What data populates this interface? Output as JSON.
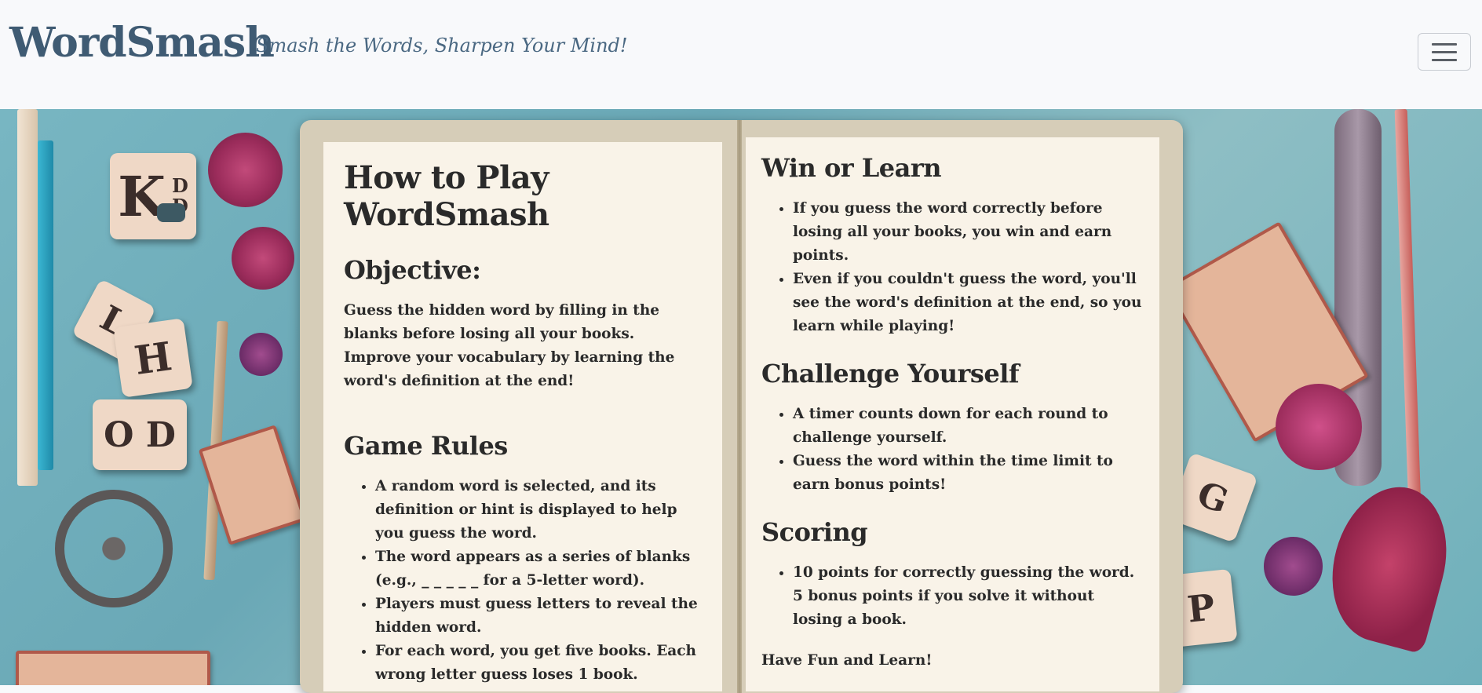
{
  "header": {
    "brand": "WordSmash",
    "tagline": "Smash the Words, Sharpen Your Mind!"
  },
  "background_tiles": [
    "K",
    "D",
    "D",
    "L",
    "H",
    "O D",
    "P",
    "G"
  ],
  "left_page": {
    "title": "How to Play WordSmash",
    "objective_heading": "Objective:",
    "objective_text": "Guess the hidden word by filling in the blanks before losing all your books. Improve your vocabulary by learning the word's definition at the end!",
    "rules_heading": "Game Rules",
    "rules": [
      "A random word is selected, and its definition or hint is displayed to help you guess the word.",
      "The word appears as a series of blanks (e.g., _ _ _ _ _ for a 5-letter word).",
      "Players must guess letters to reveal the hidden word.",
      "For each word, you get five books. Each wrong letter guess loses 1 book."
    ]
  },
  "right_page": {
    "win_heading": "Win or Learn",
    "win_items": [
      "If you guess the word correctly before losing all your books, you win and earn points.",
      "Even if you couldn't guess the word, you'll see the word's definition at the end, so you learn while playing!"
    ],
    "challenge_heading": "Challenge Yourself",
    "challenge_items": [
      "A timer counts down for each round to challenge yourself.",
      "Guess the word within the time limit to earn bonus points!"
    ],
    "scoring_heading": "Scoring",
    "scoring_items": [
      "10 points for correctly guessing the word. 5 bonus points if you solve it without losing a book."
    ],
    "closing": "Have Fun and Learn!"
  }
}
